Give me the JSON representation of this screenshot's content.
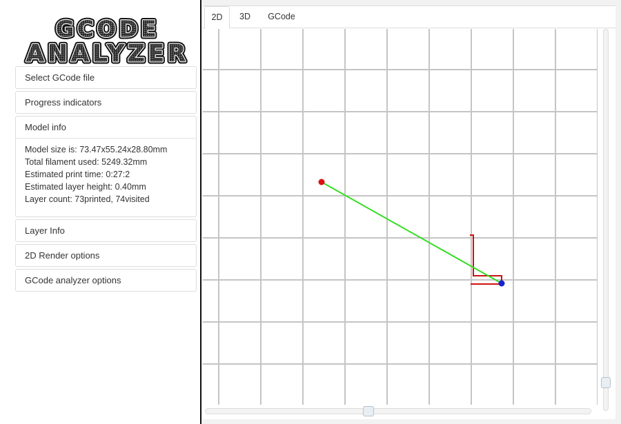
{
  "logo": {
    "line1": "GCODE",
    "line2": "ANALYZER"
  },
  "sidebar": {
    "panels": [
      {
        "label": "Select GCode file"
      },
      {
        "label": "Progress indicators"
      },
      {
        "label": "Model info"
      },
      {
        "label": "Layer Info"
      },
      {
        "label": "2D Render options"
      },
      {
        "label": "GCode analyzer options"
      }
    ],
    "model_info": {
      "lines": [
        "Model size is: 73.47x55.24x28.80mm",
        "Total filament used: 5249.32mm",
        "Estimated print time: 0:27:2",
        "Estimated layer height: 0.40mm",
        "Layer count: 73printed, 74visited"
      ]
    }
  },
  "tabs": [
    {
      "label": "2D",
      "active": true
    },
    {
      "label": "3D",
      "active": false
    },
    {
      "label": "GCode",
      "active": false
    }
  ],
  "render": {
    "grid_color": "#c4c4c4",
    "travel_color": "#33dd22",
    "extrude_color": "#cc1111",
    "start_marker_color": "#dd1111",
    "end_marker_color": "#1a22cc"
  },
  "colors": {
    "accent_border": "#dddddd",
    "sidebar_divider": "#111111"
  }
}
